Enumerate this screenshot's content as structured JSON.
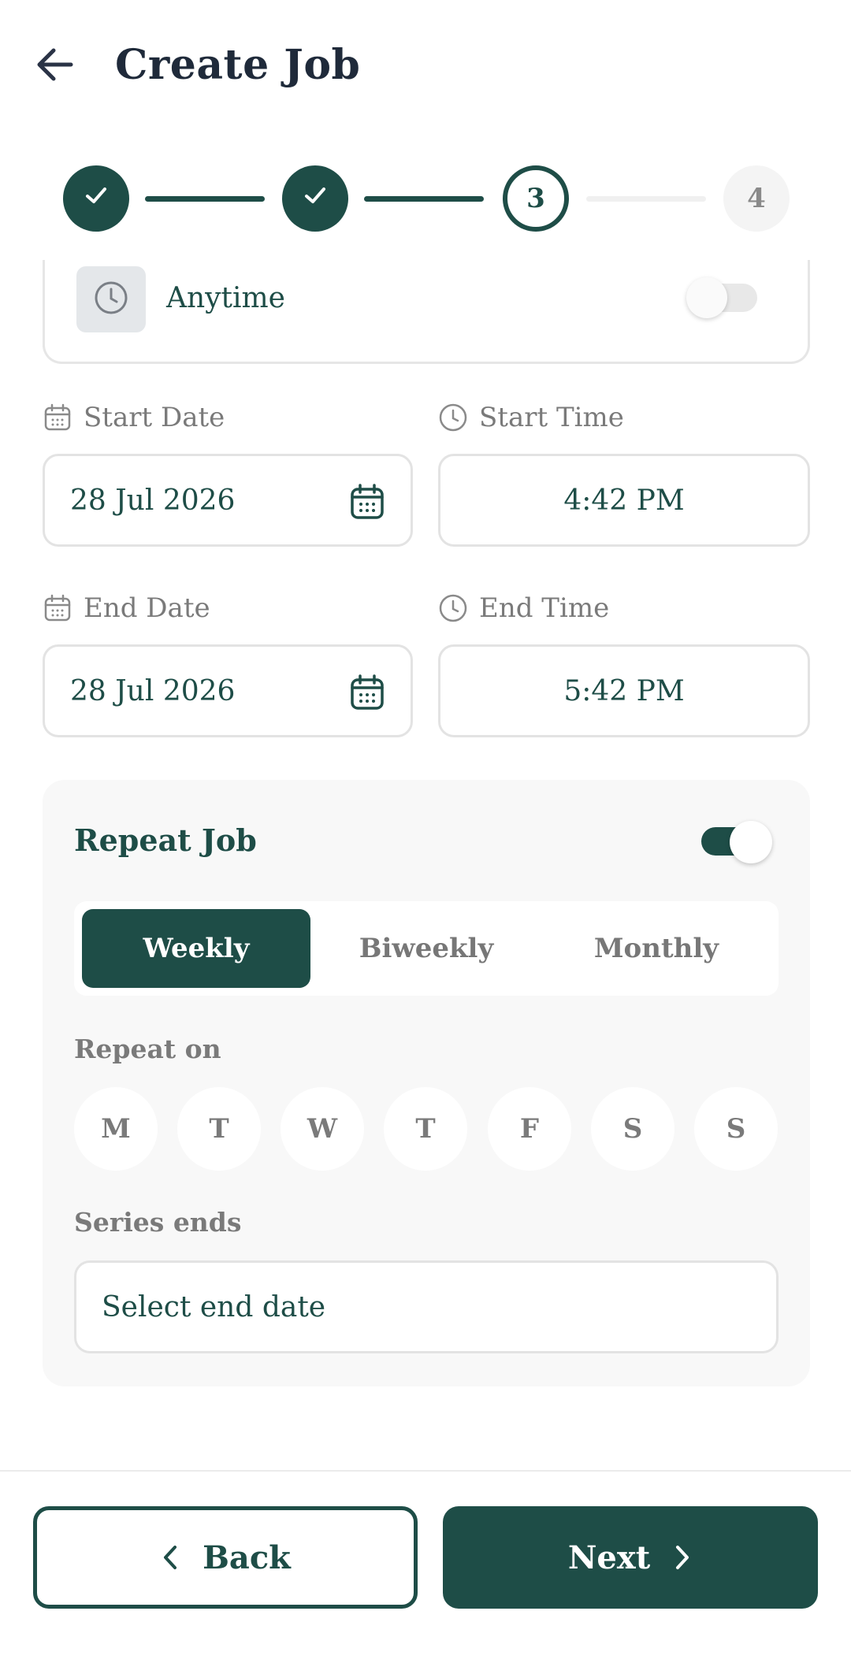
{
  "header": {
    "title": "Create Job",
    "back_icon": "arrow-left-icon"
  },
  "stepper": {
    "steps": [
      {
        "state": "done",
        "label": ""
      },
      {
        "state": "done",
        "label": ""
      },
      {
        "state": "current",
        "label": "3"
      },
      {
        "state": "todo",
        "label": "4"
      }
    ]
  },
  "anytime": {
    "label": "Anytime",
    "enabled": false
  },
  "start_date": {
    "label": "Start Date",
    "value": "28 Jul 2026"
  },
  "start_time": {
    "label": "Start Time",
    "value": "4:42 PM"
  },
  "end_date": {
    "label": "End Date",
    "value": "28 Jul 2026"
  },
  "end_time": {
    "label": "End Time",
    "value": "5:42 PM"
  },
  "repeat": {
    "title": "Repeat Job",
    "enabled": true,
    "frequencies": [
      {
        "label": "Weekly",
        "selected": true
      },
      {
        "label": "Biweekly",
        "selected": false
      },
      {
        "label": "Monthly",
        "selected": false
      }
    ],
    "repeat_on_label": "Repeat on",
    "days": [
      "M",
      "T",
      "W",
      "T",
      "F",
      "S",
      "S"
    ],
    "series_ends_label": "Series ends",
    "end_placeholder": "Select end date"
  },
  "footer": {
    "back_label": "Back",
    "next_label": "Next"
  },
  "colors": {
    "primary": "#1e4d47",
    "muted": "#7a7a7a",
    "panel": "#f8f8f8"
  }
}
